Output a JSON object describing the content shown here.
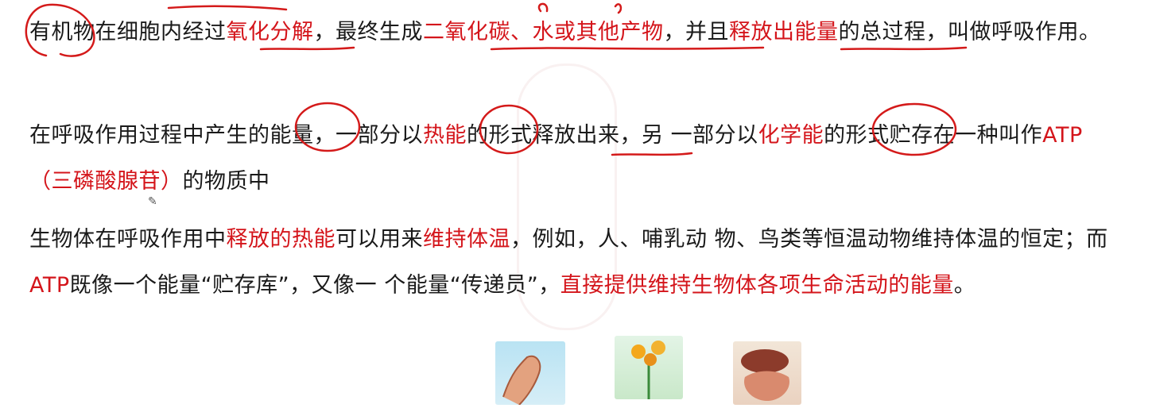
{
  "p1": {
    "t1": "有机物在细胞内经过",
    "t2": "氧化分解",
    "t3": "，最终生成",
    "t4": "二氧化碳、水或其他产物",
    "t5": "，并且",
    "t6": "释放出能量",
    "t7": "的总过程，叫做呼吸作用。"
  },
  "p2": {
    "t1": "在呼吸作用过程中产生的能量，一部分以",
    "t2": "热能",
    "t3": "的形式释放出来，另 一部分以",
    "t4": "化学能",
    "t5": "的形式贮存在一种叫作",
    "t6": "ATP（三磷酸腺苷）",
    "t7": "的物质中"
  },
  "p3": {
    "t1": "生物体在呼吸作用中",
    "t2": "释放的热能",
    "t3": "可以用来",
    "t4": "维持体温",
    "t5": "，例如，人、哺乳动 物、鸟类等恒温动物维持体温的恒定；而",
    "t6": "ATP",
    "t7": "既像一个能量“贮存库”，又像一 个能量“传递员”，",
    "t8": "直接提供维持生物体各项生命活动的能量",
    "t9": "。"
  },
  "colors": {
    "highlight": "#d4151b",
    "ink": "#d41a1a",
    "text": "#1a1a1a"
  }
}
